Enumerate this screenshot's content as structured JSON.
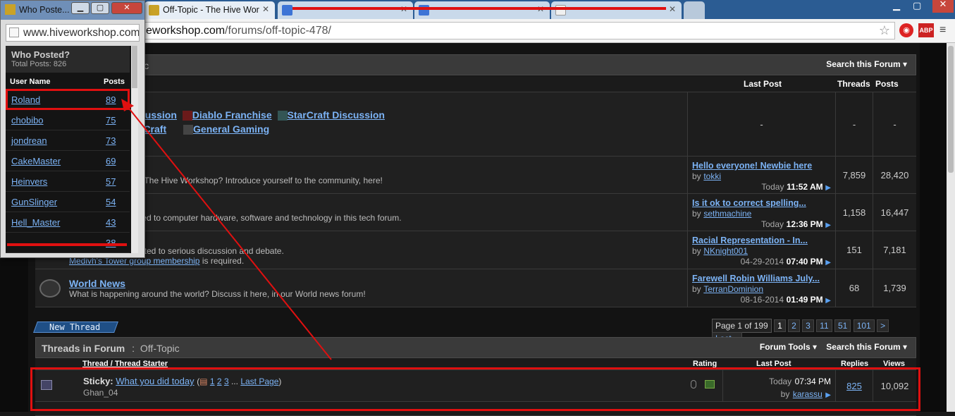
{
  "browser": {
    "tabs": [
      {
        "title": "Who Poste...",
        "favicon": "hive-icon"
      },
      {
        "title": "Off-Topic - The Hive Wor",
        "favicon": "hive-icon"
      },
      {
        "title": "",
        "favicon": "google-icon"
      },
      {
        "title": "",
        "favicon": "google-icon"
      },
      {
        "title": "",
        "favicon": "page-icon"
      }
    ],
    "url_host_fragment": "eworkshop.com",
    "url_path": "/forums/off-topic-478/",
    "ext_badge": "1"
  },
  "popup": {
    "url": "www.hiveworkshop.com",
    "title": "Who Posted?",
    "total_posts": "Total Posts: 826",
    "col_user": "User Name",
    "col_posts": "Posts",
    "rows": [
      {
        "name": "Roland",
        "posts": "89"
      },
      {
        "name": "chobibo",
        "posts": "75"
      },
      {
        "name": "jondrean",
        "posts": "73"
      },
      {
        "name": "CakeMaster",
        "posts": "69"
      },
      {
        "name": "Heinvers",
        "posts": "57"
      },
      {
        "name": "GunSlinger",
        "posts": "54"
      },
      {
        "name": "Hell_Master",
        "posts": "43"
      },
      {
        "name": "",
        "posts": "38"
      }
    ]
  },
  "forum": {
    "breadcrumb_tail": "ic",
    "search_forum": "Search this Forum",
    "col_last_post": "Last Post",
    "col_threads": "Threads",
    "col_posts": "Posts",
    "subforums_line1": [
      "cussion",
      "Diablo Franchise",
      "StarCraft Discussion"
    ],
    "subforums_line2": [
      "rCraft",
      "General Gaming"
    ],
    "dash": "-",
    "forums": [
      {
        "name": "",
        "desc": "t The Hive Workshop? Introduce yourself to the community, here!",
        "lp_title": "Hello everyone! Newbie here",
        "lp_by": "by",
        "lp_user": "tokki",
        "lp_date": "Today",
        "lp_time": "11:52 AM",
        "threads": "7,859",
        "posts": "28,420"
      },
      {
        "name": "",
        "desc": "ted to computer hardware, software and technology in this tech forum.",
        "lp_title": "Is it ok to correct spelling...",
        "lp_by": "by",
        "lp_user": "sethmachine",
        "lp_date": "Today",
        "lp_time": "12:36 PM",
        "threads": "1,158",
        "posts": "16,447"
      },
      {
        "name": "",
        "desc": "ated to serious discussion and debate.",
        "desc2_link": "Medivh's Tower group membership",
        "desc2_rest": " is required.",
        "lp_title": "Racial Representation - In...",
        "lp_by": "by",
        "lp_user": "NKnight001",
        "lp_date": "04-29-2014",
        "lp_time": "07:40 PM",
        "threads": "151",
        "posts": "7,181"
      },
      {
        "name": "World News",
        "desc": "What is happening around the world? Discuss it here, in our World news forum!",
        "lp_title": "Farewell Robin Williams July...",
        "lp_by": "by",
        "lp_user": "TerranDominion",
        "lp_date": "08-16-2014",
        "lp_time": "01:49 PM",
        "threads": "68",
        "posts": "1,739"
      }
    ],
    "new_thread": "New Thread",
    "pagination": {
      "label": "Page 1 of 199",
      "pages": [
        "1",
        "2",
        "3",
        "11",
        "51",
        "101",
        ">",
        "Last »"
      ]
    },
    "threads_header": "Threads in Forum",
    "threads_header_sep": ":",
    "threads_header_forum": "Off-Topic",
    "forum_tools": "Forum Tools",
    "col_thread": "Thread / Thread Starter",
    "col_rating": "Rating",
    "col_lastpost": "Last Post",
    "col_replies": "Replies",
    "col_views": "Views",
    "sticky": {
      "prefix": "Sticky:",
      "title": "What you did today",
      "pages": [
        "1",
        "2",
        "3"
      ],
      "ellipsis": "...",
      "last_page": "Last Page",
      "starter": "Ghan_04",
      "lp_date": "Today",
      "lp_time": "07:34 PM",
      "lp_by": "by",
      "lp_user": "karassu",
      "replies": "825",
      "views": "10,092"
    }
  },
  "colors": {
    "annotation": "#e01010",
    "link": "#7cb3f5",
    "chrome_blue": "#2b5c93"
  }
}
